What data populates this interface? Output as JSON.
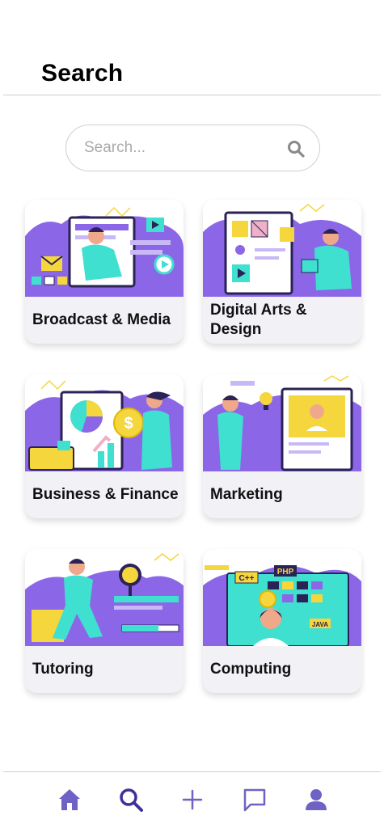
{
  "header": {
    "title": "Search"
  },
  "search": {
    "placeholder": "Search..."
  },
  "categories": [
    {
      "label": "Broadcast & Media",
      "icon": "broadcast-media-illustration"
    },
    {
      "label": "Digital Arts & Design",
      "icon": "digital-arts-illustration"
    },
    {
      "label": "Business & Finance",
      "icon": "business-finance-illustration"
    },
    {
      "label": "Marketing",
      "icon": "marketing-illustration"
    },
    {
      "label": "Tutoring",
      "icon": "tutoring-illustration"
    },
    {
      "label": "Computing",
      "icon": "computing-illustration"
    }
  ],
  "illustration_text": {
    "cpp": "C++",
    "php": "PHP",
    "java": "JAVA",
    "dollar": "$"
  },
  "tabbar": {
    "items": [
      {
        "name": "home",
        "icon": "home-icon"
      },
      {
        "name": "search",
        "icon": "search-icon"
      },
      {
        "name": "add",
        "icon": "plus-icon"
      },
      {
        "name": "messages",
        "icon": "chat-icon"
      },
      {
        "name": "profile",
        "icon": "user-icon"
      }
    ]
  },
  "colors": {
    "accent": "#6e63c4",
    "illustration_purple": "#8b67e8",
    "illustration_teal": "#3fe0d0",
    "illustration_yellow": "#f5d63d",
    "card_bg": "#f1f1f6"
  }
}
